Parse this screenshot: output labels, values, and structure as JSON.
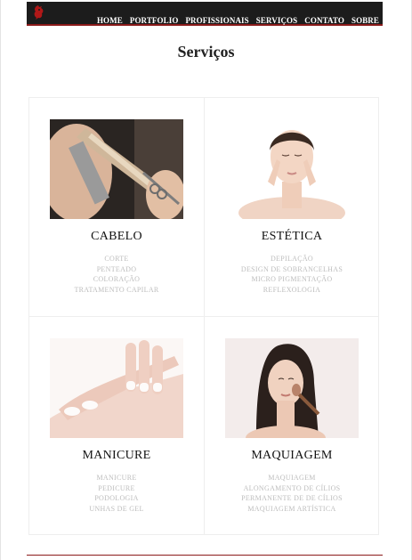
{
  "nav": {
    "items": [
      "HOME",
      "PORTFOLIO",
      "PROFISSIONAIS",
      "SERVIÇOS",
      "CONTATO",
      "SOBRE"
    ]
  },
  "page": {
    "title": "Serviços"
  },
  "services": [
    {
      "title": "CABELO",
      "items": [
        "CORTE",
        "PENTEADO",
        "COLORAÇÃO",
        "TRATAMENTO CAPILAR"
      ]
    },
    {
      "title": "ESTÉTICA",
      "items": [
        "DEPILAÇÃO",
        "DESIGN DE SOBRANCELHAS",
        "MICRO PIGMENTAÇÃO",
        "REFLEXOLOGIA"
      ]
    },
    {
      "title": "MANICURE",
      "items": [
        "MANICURE",
        "PEDICURE",
        "PODOLOGIA",
        "UNHAS DE GEL"
      ]
    },
    {
      "title": "MAQUIAGEM",
      "items": [
        "MAQUIAGEM",
        "ALONGAMENTO DE CÍLIOS",
        "PERMANENTE DE DE CÍLIOS",
        "MAQUIAGEM ARTÍSTICA"
      ]
    }
  ],
  "colors": {
    "navbar": "#1c1c1c",
    "accent": "#8b1a1a",
    "muted_text": "#bdbdbd"
  }
}
